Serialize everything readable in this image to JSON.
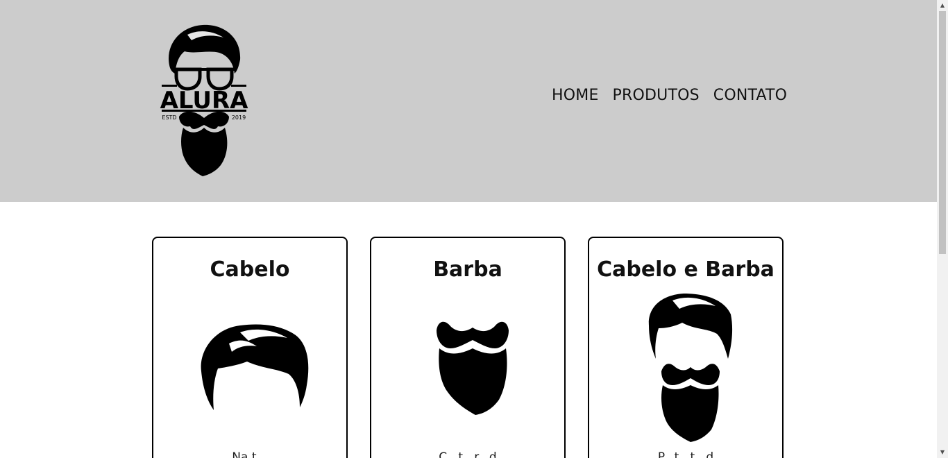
{
  "logo": {
    "brand": "ALURA",
    "estd": "ESTD",
    "year": "2019",
    "icon": "barber-logo-icon"
  },
  "nav": {
    "items": [
      "HOME",
      "PRODUTOS",
      "CONTATO"
    ]
  },
  "cards": [
    {
      "title": "Cabelo",
      "icon": "hair-icon",
      "text": "Na t..."
    },
    {
      "title": "Barba",
      "icon": "beard-icon",
      "text": "C...t...r...d"
    },
    {
      "title": "Cabelo e Barba",
      "icon": "hair-and-beard-icon",
      "text": "P...t...t...d"
    }
  ],
  "colors": {
    "header_bg": "#cccccc",
    "page_bg": "#ffffff",
    "ink": "#000000"
  }
}
